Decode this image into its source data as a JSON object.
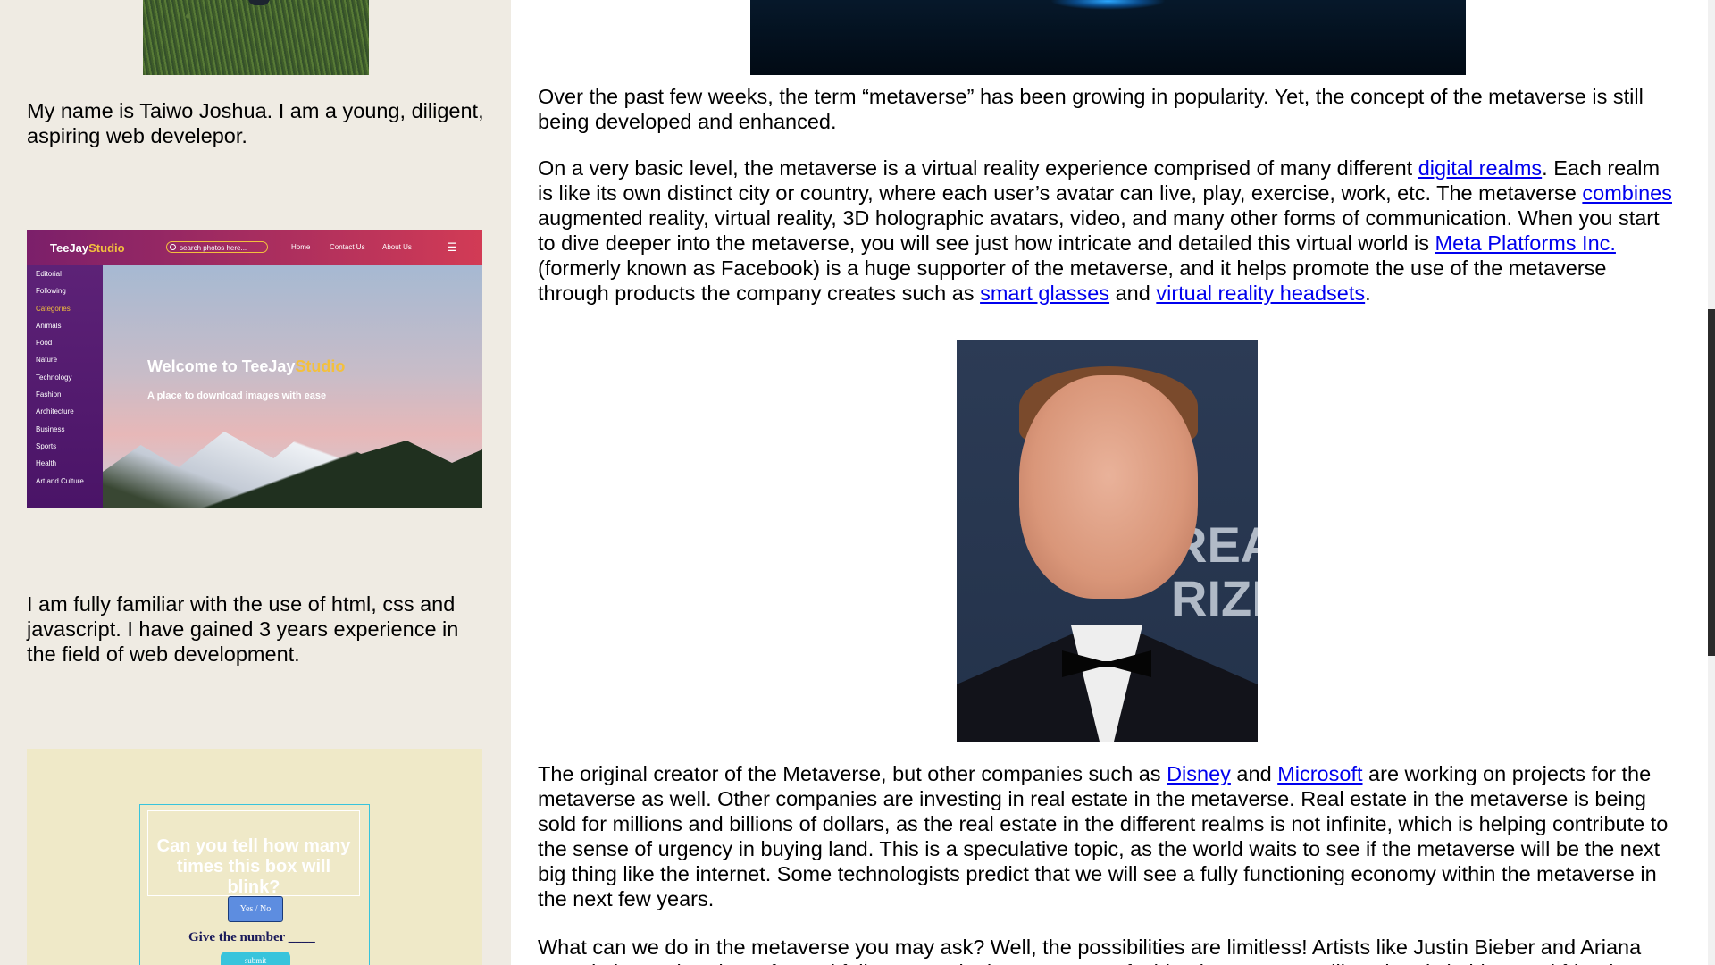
{
  "sidebar": {
    "intro": "My name is Taiwo Joshua. I am a young, diligent, aspiring web develepor.",
    "experience": "I am fully familiar with the use of html, css and javascript. I have gained 3 years experience in the field of web development.",
    "project1": {
      "brand_main": "TeeJay",
      "brand_accent": "Studio",
      "search_placeholder": "search photos here...",
      "nav_links": [
        "Home",
        "Contact Us",
        "About Us"
      ],
      "categories": [
        "Editorial",
        "Following",
        "Categories",
        "Animals",
        "Food",
        "Nature",
        "Technology",
        "Fashion",
        "Architecture",
        "Business",
        "Sports",
        "Health",
        "Art and Culture"
      ],
      "active_category": "Categories",
      "welcome_prefix": "Welcome to TeeJay",
      "welcome_accent": "Studio",
      "tagline": "A place to download images with ease"
    },
    "project2": {
      "question": "Can you tell how many times this box will blink?",
      "yes_no": "Yes  /  No",
      "give_number": "Give the number ____",
      "submit": "submit"
    }
  },
  "article": {
    "p1": "Over the past few weeks, the term “metaverse” has been growing in popularity. Yet, the concept of the metaverse is still being developed and enhanced.",
    "p2": {
      "t1": "On a very basic level, the metaverse is a virtual reality experience comprised of many different ",
      "link1": "digital realms",
      "t2": ". Each realm is like its own distinct city or country, where each user’s avatar can live, play, exercise, work, etc. The metaverse ",
      "link2": "combines",
      "t3": " augmented reality, virtual reality, 3D holographic avatars, video, and many other forms of communication. When you start to dive deeper into the metaverse, you will see just how intricate and detailed this virtual world is ",
      "link3": "Meta Platforms Inc.",
      "t4": " (formerly known as Facebook) is a huge supporter of the metaverse, and it helps promote the use of the metaverse through products the company creates such as ",
      "link4": "smart glasses",
      "t5": " and ",
      "link5": "virtual reality headsets",
      "t6": "."
    },
    "portrait_backdrop_text": "REA\nRIZI",
    "p3": {
      "t1": "The original creator of the Metaverse, but other companies such as ",
      "link1": "Disney",
      "t2": " and ",
      "link2": "Microsoft",
      "t3": " are working on projects for the metaverse as well. Other companies are investing in real estate in the metaverse. Real estate in the metaverse is being sold for millions and billions of dollars, as the real estate in the different realms is not infinite, which is helping contribute to the sense of urgency in buying land. This is a speculative topic, as the world waits to see if the metaverse will be the next big thing like the internet. Some technologists predict that we will see a fully functioning economy within the metaverse in the next few years."
    },
    "p4": "What can we do in the metaverse you may ask? Well, the possibilities are limitless! Artists like Justin Bieber and Ariana Grande have already performed full concerts in the metaverse, fashion houses are selling virtual clothing, and friends are meeting up to hang out in virtual worlds."
  },
  "colors": {
    "sidebar_bg": "#efebe3",
    "link": "#0000ee",
    "accent_yellow": "#f3c03d"
  }
}
